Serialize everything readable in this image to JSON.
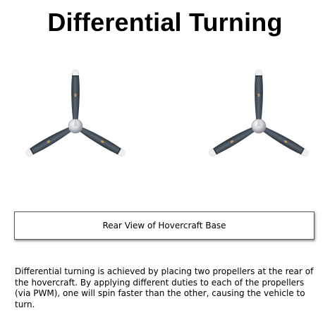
{
  "title": "Differential Turning",
  "base_box_label": "Rear View of Hovercraft Base",
  "caption": "Differential turning is achieved by placing two propellers at the rear of the hovercraft.  By applying different duties to each of the propellers (via PWM), one will spin faster than the other, causing the vehicle to turn.",
  "propellers": [
    {
      "name": "left-propeller-image"
    },
    {
      "name": "right-propeller-image"
    }
  ],
  "colors": {
    "background": "#ffffff",
    "blade": "#4b5560",
    "blade_dark": "#2f363d",
    "blade_tip": "#e8e8e8",
    "hub": "#c9ccd0",
    "box_border": "#5a5a5a"
  }
}
